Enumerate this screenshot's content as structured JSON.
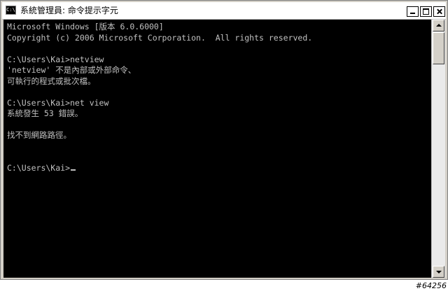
{
  "window": {
    "title": "系統管理員: 命令提示字元",
    "icon": "console-app-icon",
    "icon_text": "C:\\"
  },
  "console": {
    "lines": [
      "Microsoft Windows [版本 6.0.6000]",
      "Copyright (c) 2006 Microsoft Corporation.  All rights reserved.",
      "",
      "C:\\Users\\Kai>netview",
      "'netview' 不是內部或外部命令、",
      "可執行的程式或批次檔。",
      "",
      "C:\\Users\\Kai>net view",
      "系統發生 53 錯誤。",
      "",
      "找不到網路路徑。",
      "",
      "",
      "C:\\Users\\Kai>"
    ],
    "text_color": "#c0c0c0",
    "background_color": "#000000"
  },
  "controls": {
    "minimize": "minimize-icon",
    "maximize": "maximize-icon",
    "close": "close-icon"
  },
  "watermark": "#64256"
}
